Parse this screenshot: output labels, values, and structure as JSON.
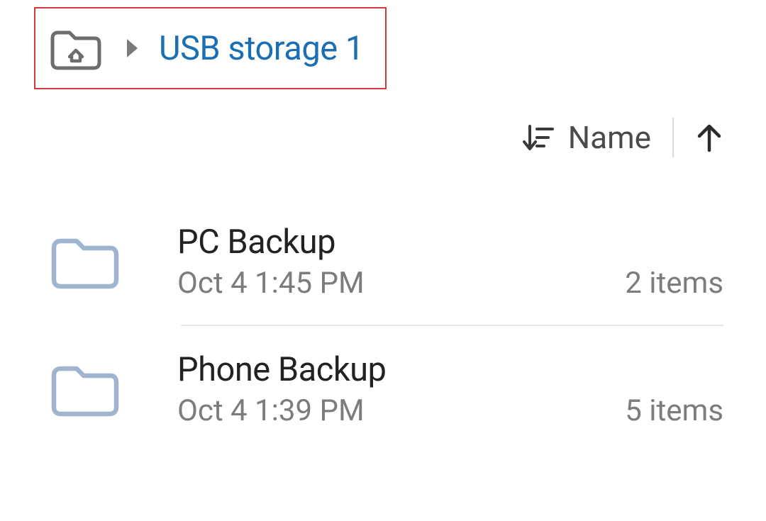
{
  "breadcrumb": {
    "current": "USB storage 1"
  },
  "sort": {
    "label": "Name",
    "direction": "asc"
  },
  "items": [
    {
      "name": "PC Backup",
      "date": "Oct 4 1:45 PM",
      "count": "2 items"
    },
    {
      "name": "Phone Backup",
      "date": "Oct 4 1:39 PM",
      "count": "5 items"
    }
  ]
}
